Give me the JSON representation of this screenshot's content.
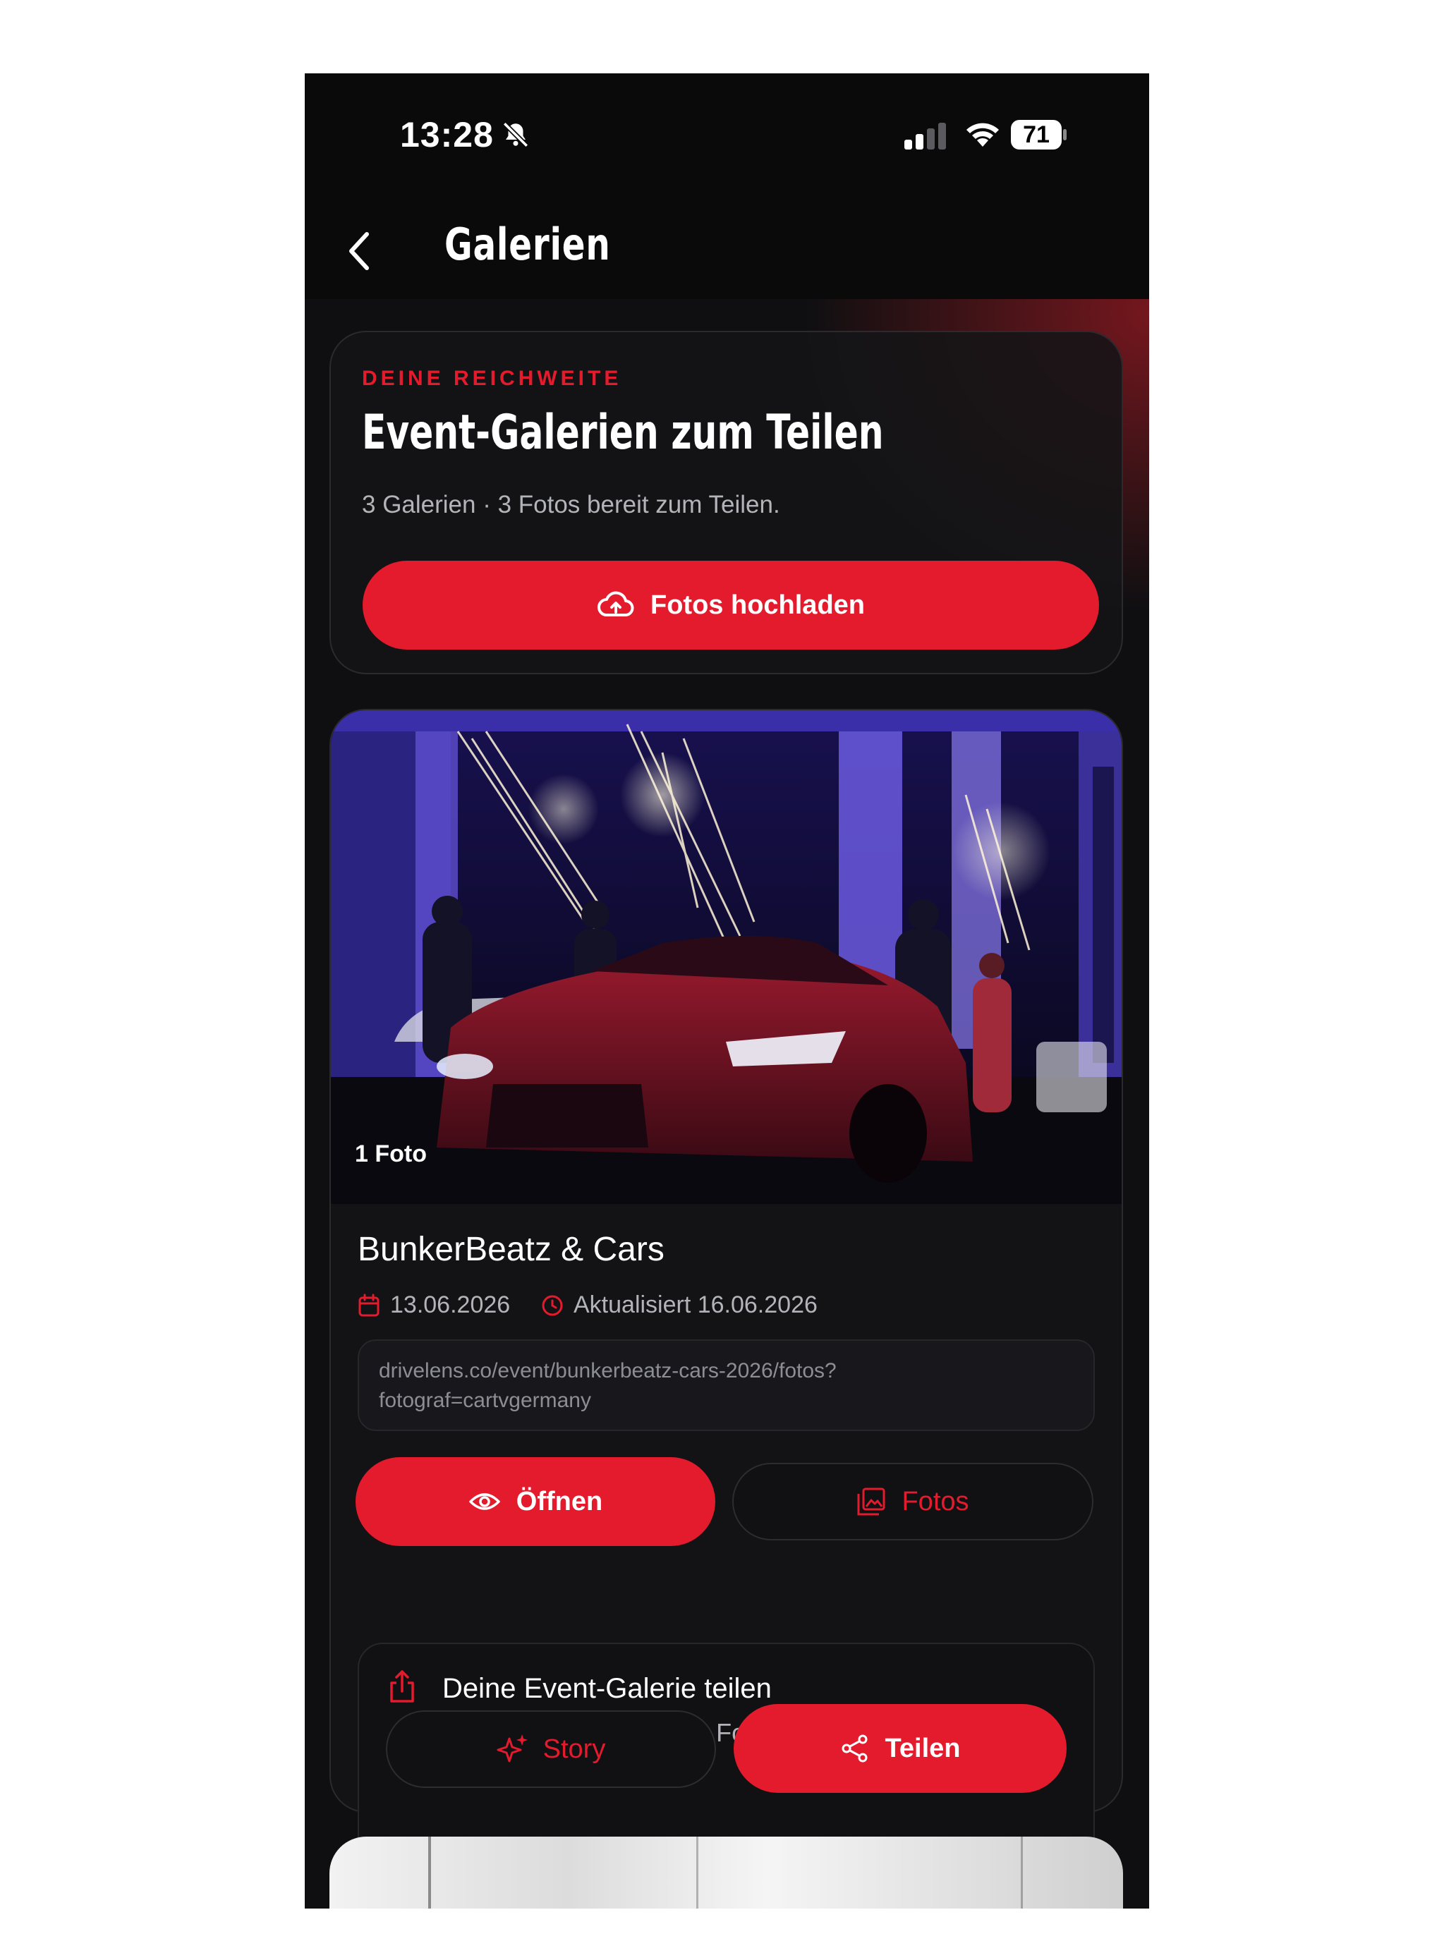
{
  "status_bar": {
    "time": "13:28",
    "battery": "71"
  },
  "nav": {
    "title": "Galerien"
  },
  "hero": {
    "eyebrow": "DEINE REICHWEITE",
    "title": "Event-Galerien zum Teilen",
    "subtitle": "3 Galerien · 3 Fotos bereit zum Teilen.",
    "upload_label": "Fotos hochladen"
  },
  "gallery": {
    "photo_count": "1 Foto",
    "title": "BunkerBeatz & Cars",
    "date": "13.06.2026",
    "updated": "Aktualisiert 16.06.2026",
    "url_line1": "drivelens.co/event/bunkerbeatz-cars-2026/fotos?",
    "url_line2": "fotograf=cartvgermany",
    "open_label": "Öffnen",
    "photos_label": "Fotos",
    "share": {
      "title": "Deine Event-Galerie teilen",
      "subtitle": "BunkerBeatz & Cars · 1 Foto",
      "story_label": "Story",
      "share_label": "Teilen"
    }
  },
  "colors": {
    "accent": "#e31b2d",
    "background": "#0f0f11",
    "card": "#131316"
  },
  "icons": [
    "bell-slash-icon",
    "signal-icon",
    "wifi-icon",
    "battery-icon",
    "back-chevron-icon",
    "cloud-upload-icon",
    "calendar-icon",
    "clock-icon",
    "eye-icon",
    "image-gallery-icon",
    "share-upload-icon",
    "sparkles-icon",
    "share-nodes-icon"
  ]
}
